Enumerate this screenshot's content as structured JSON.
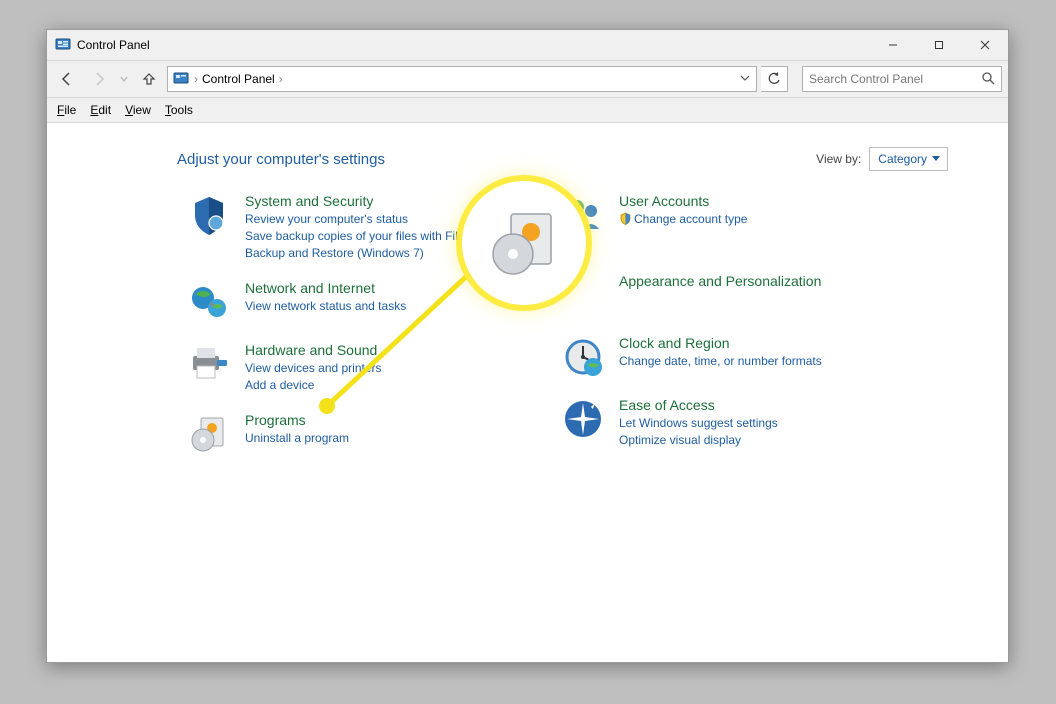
{
  "window": {
    "title": "Control Panel"
  },
  "address": {
    "crumb1": "Control Panel",
    "crumb_sep1": "›",
    "crumb_sep2": "›"
  },
  "search": {
    "placeholder": "Search Control Panel"
  },
  "menubar": {
    "file": "File",
    "edit": "Edit",
    "view": "View",
    "tools": "Tools"
  },
  "heading": "Adjust your computer's settings",
  "viewby": {
    "label": "View by:",
    "value": "Category"
  },
  "categories": {
    "system_security": {
      "title": "System and Security",
      "links": [
        "Review your computer's status",
        "Save backup copies of your files with File History",
        "Backup and Restore (Windows 7)"
      ]
    },
    "network_internet": {
      "title": "Network and Internet",
      "links": [
        "View network status and tasks"
      ]
    },
    "hardware_sound": {
      "title": "Hardware and Sound",
      "links": [
        "View devices and printers",
        "Add a device"
      ]
    },
    "programs": {
      "title": "Programs",
      "links": [
        "Uninstall a program"
      ]
    },
    "user_accounts": {
      "title": "User Accounts",
      "links": [
        "Change account type"
      ]
    },
    "appearance": {
      "title": "Appearance and Personalization",
      "links": []
    },
    "clock_region": {
      "title": "Clock and Region",
      "links": [
        "Change date, time, or number formats"
      ]
    },
    "ease_of_access": {
      "title": "Ease of Access",
      "links": [
        "Let Windows suggest settings",
        "Optimize visual display"
      ]
    }
  }
}
